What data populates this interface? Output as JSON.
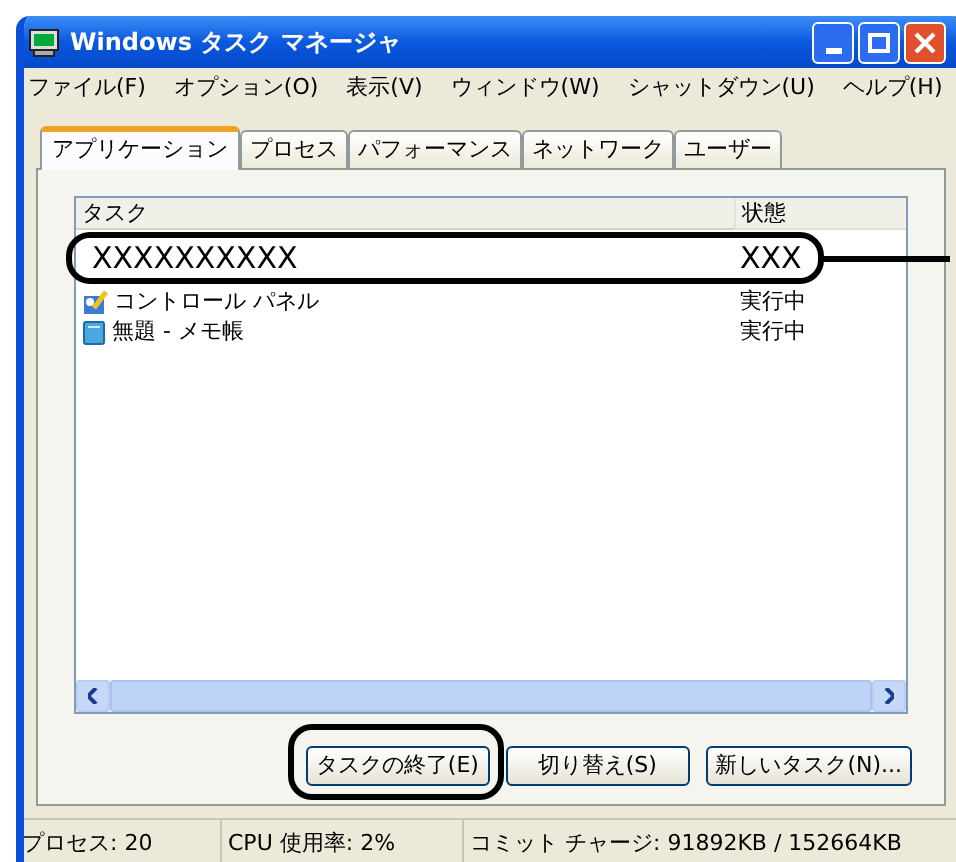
{
  "window": {
    "title": "Windows タスク マネージャ"
  },
  "menu": [
    "ファイル(F)",
    "オプション(O)",
    "表示(V)",
    "ウィンドウ(W)",
    "シャットダウン(U)",
    "ヘルプ(H)"
  ],
  "tabs": [
    {
      "label": "アプリケーション",
      "selected": true
    },
    {
      "label": "プロセス",
      "selected": false
    },
    {
      "label": "パフォーマンス",
      "selected": false
    },
    {
      "label": "ネットワーク",
      "selected": false
    },
    {
      "label": "ユーザー",
      "selected": false
    }
  ],
  "table": {
    "columns": [
      "タスク",
      "状態"
    ],
    "rows": [
      {
        "task": "XXXXXXXXXX",
        "status": "XXX",
        "callout": true
      },
      {
        "task": "コントロール パネル",
        "status": "実行中",
        "kind": "control",
        "callout": false
      },
      {
        "task": "無題 - メモ帳",
        "status": "実行中",
        "kind": "notepad",
        "callout": false
      }
    ]
  },
  "buttons": [
    {
      "label": "タスクの終了(E)",
      "callout": true
    },
    {
      "label": "切り替え(S)",
      "callout": false
    },
    {
      "label": "新しいタスク(N)...",
      "callout": false
    }
  ],
  "status_bar": [
    "プロセス: 20",
    "CPU 使用率: 2%",
    "コミット チャージ: 91892KB / 152664KB"
  ]
}
